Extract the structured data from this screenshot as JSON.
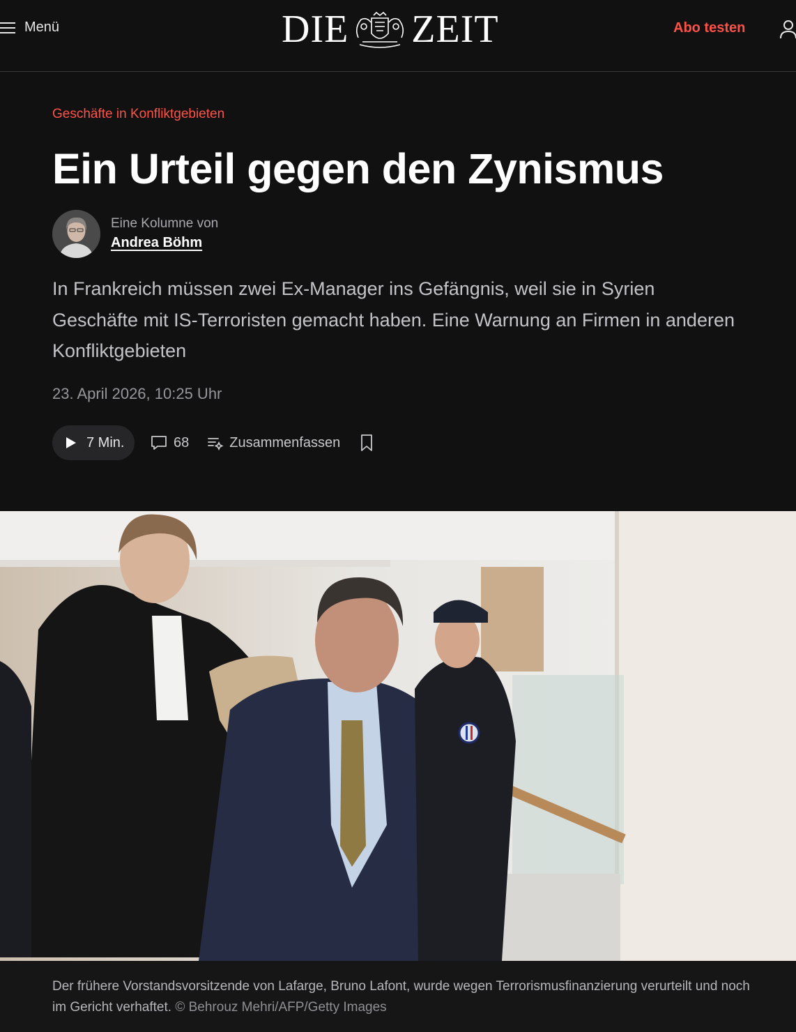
{
  "header": {
    "menu_label": "Menü",
    "logo_left": "DIE",
    "logo_right": "ZEIT",
    "abo_label": "Abo testen"
  },
  "article": {
    "kicker": "Geschäfte in Konfliktgebieten",
    "title": "Ein Urteil gegen den Zynismus",
    "author_prefix": "Eine Kolumne von",
    "author_name": "Andrea Böhm",
    "lead": "In Frankreich müssen zwei Ex-Manager ins Gefängnis, weil sie in Syrien Geschäfte mit IS-Terroristen gemacht haben. Eine Warnung an Firmen in anderen Konfliktgebieten",
    "date": "23. April 2026, 10:25 Uhr"
  },
  "actions": {
    "audio_label": "7 Min.",
    "comments_count": "68",
    "summarize_label": "Zusammenfassen"
  },
  "image": {
    "caption": "Der frühere Vorstandsvorsitzende von Lafarge, Bruno Lafont, wurde wegen Terrorismusfinanzierung verurteilt und noch im Gericht verhaftet.",
    "credit": "© Behrouz Mehri/AFP/Getty Images"
  },
  "colors": {
    "background": "#111112",
    "accent": "#ff5247",
    "text": "#f2f2f2"
  }
}
